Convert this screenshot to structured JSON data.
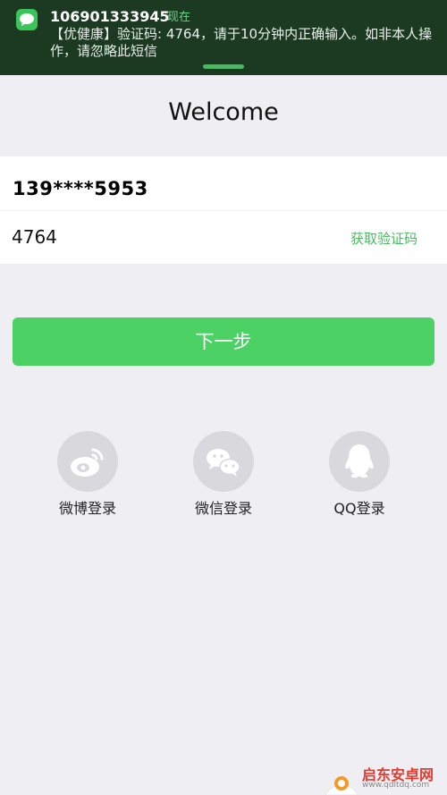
{
  "notification": {
    "sender": "106901333945",
    "time": "现在",
    "message": "【优健康】验证码: 4764，请于10分钟内正确输入。如非本人操作，请忽略此短信",
    "icon": "message-bubble-icon"
  },
  "header": {
    "title": "Welcome"
  },
  "form": {
    "phone": "139****5953",
    "code": "4764",
    "get_code_label": "获取验证码"
  },
  "actions": {
    "next_label": "下一步"
  },
  "social": [
    {
      "label": "微博登录",
      "icon": "weibo-icon"
    },
    {
      "label": "微信登录",
      "icon": "wechat-icon"
    },
    {
      "label": "QQ登录",
      "icon": "qq-icon"
    }
  ],
  "watermark": {
    "text": "启东安卓网",
    "url": "www.qdltdq.com"
  },
  "colors": {
    "accent": "#4cd164",
    "link": "#4cb865",
    "notification_bg": "#1c3a22",
    "background": "#efeef3",
    "social_circle": "#d9d9dd"
  }
}
